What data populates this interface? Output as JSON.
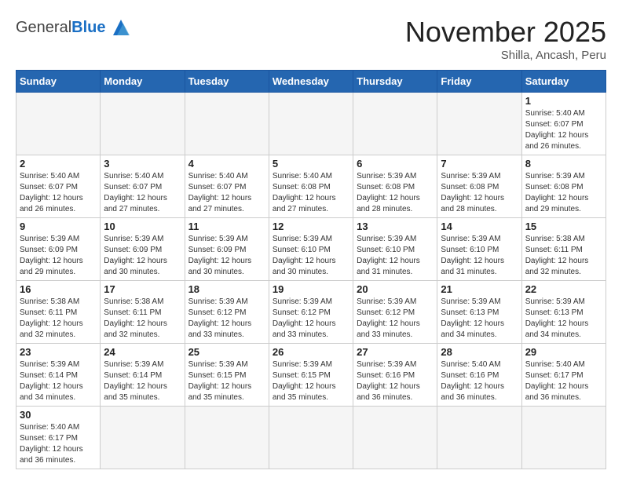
{
  "header": {
    "logo_general": "General",
    "logo_blue": "Blue",
    "month_title": "November 2025",
    "location": "Shilla, Ancash, Peru"
  },
  "weekdays": [
    "Sunday",
    "Monday",
    "Tuesday",
    "Wednesday",
    "Thursday",
    "Friday",
    "Saturday"
  ],
  "days": {
    "1": {
      "sunrise": "5:40 AM",
      "sunset": "6:07 PM",
      "daylight": "12 hours and 26 minutes."
    },
    "2": {
      "sunrise": "5:40 AM",
      "sunset": "6:07 PM",
      "daylight": "12 hours and 26 minutes."
    },
    "3": {
      "sunrise": "5:40 AM",
      "sunset": "6:07 PM",
      "daylight": "12 hours and 27 minutes."
    },
    "4": {
      "sunrise": "5:40 AM",
      "sunset": "6:07 PM",
      "daylight": "12 hours and 27 minutes."
    },
    "5": {
      "sunrise": "5:40 AM",
      "sunset": "6:08 PM",
      "daylight": "12 hours and 27 minutes."
    },
    "6": {
      "sunrise": "5:39 AM",
      "sunset": "6:08 PM",
      "daylight": "12 hours and 28 minutes."
    },
    "7": {
      "sunrise": "5:39 AM",
      "sunset": "6:08 PM",
      "daylight": "12 hours and 28 minutes."
    },
    "8": {
      "sunrise": "5:39 AM",
      "sunset": "6:08 PM",
      "daylight": "12 hours and 29 minutes."
    },
    "9": {
      "sunrise": "5:39 AM",
      "sunset": "6:09 PM",
      "daylight": "12 hours and 29 minutes."
    },
    "10": {
      "sunrise": "5:39 AM",
      "sunset": "6:09 PM",
      "daylight": "12 hours and 30 minutes."
    },
    "11": {
      "sunrise": "5:39 AM",
      "sunset": "6:09 PM",
      "daylight": "12 hours and 30 minutes."
    },
    "12": {
      "sunrise": "5:39 AM",
      "sunset": "6:10 PM",
      "daylight": "12 hours and 30 minutes."
    },
    "13": {
      "sunrise": "5:39 AM",
      "sunset": "6:10 PM",
      "daylight": "12 hours and 31 minutes."
    },
    "14": {
      "sunrise": "5:39 AM",
      "sunset": "6:10 PM",
      "daylight": "12 hours and 31 minutes."
    },
    "15": {
      "sunrise": "5:38 AM",
      "sunset": "6:11 PM",
      "daylight": "12 hours and 32 minutes."
    },
    "16": {
      "sunrise": "5:38 AM",
      "sunset": "6:11 PM",
      "daylight": "12 hours and 32 minutes."
    },
    "17": {
      "sunrise": "5:38 AM",
      "sunset": "6:11 PM",
      "daylight": "12 hours and 32 minutes."
    },
    "18": {
      "sunrise": "5:39 AM",
      "sunset": "6:12 PM",
      "daylight": "12 hours and 33 minutes."
    },
    "19": {
      "sunrise": "5:39 AM",
      "sunset": "6:12 PM",
      "daylight": "12 hours and 33 minutes."
    },
    "20": {
      "sunrise": "5:39 AM",
      "sunset": "6:12 PM",
      "daylight": "12 hours and 33 minutes."
    },
    "21": {
      "sunrise": "5:39 AM",
      "sunset": "6:13 PM",
      "daylight": "12 hours and 34 minutes."
    },
    "22": {
      "sunrise": "5:39 AM",
      "sunset": "6:13 PM",
      "daylight": "12 hours and 34 minutes."
    },
    "23": {
      "sunrise": "5:39 AM",
      "sunset": "6:14 PM",
      "daylight": "12 hours and 34 minutes."
    },
    "24": {
      "sunrise": "5:39 AM",
      "sunset": "6:14 PM",
      "daylight": "12 hours and 35 minutes."
    },
    "25": {
      "sunrise": "5:39 AM",
      "sunset": "6:15 PM",
      "daylight": "12 hours and 35 minutes."
    },
    "26": {
      "sunrise": "5:39 AM",
      "sunset": "6:15 PM",
      "daylight": "12 hours and 35 minutes."
    },
    "27": {
      "sunrise": "5:39 AM",
      "sunset": "6:16 PM",
      "daylight": "12 hours and 36 minutes."
    },
    "28": {
      "sunrise": "5:40 AM",
      "sunset": "6:16 PM",
      "daylight": "12 hours and 36 minutes."
    },
    "29": {
      "sunrise": "5:40 AM",
      "sunset": "6:17 PM",
      "daylight": "12 hours and 36 minutes."
    },
    "30": {
      "sunrise": "5:40 AM",
      "sunset": "6:17 PM",
      "daylight": "12 hours and 36 minutes."
    }
  },
  "labels": {
    "sunrise": "Sunrise:",
    "sunset": "Sunset:",
    "daylight": "Daylight:"
  }
}
